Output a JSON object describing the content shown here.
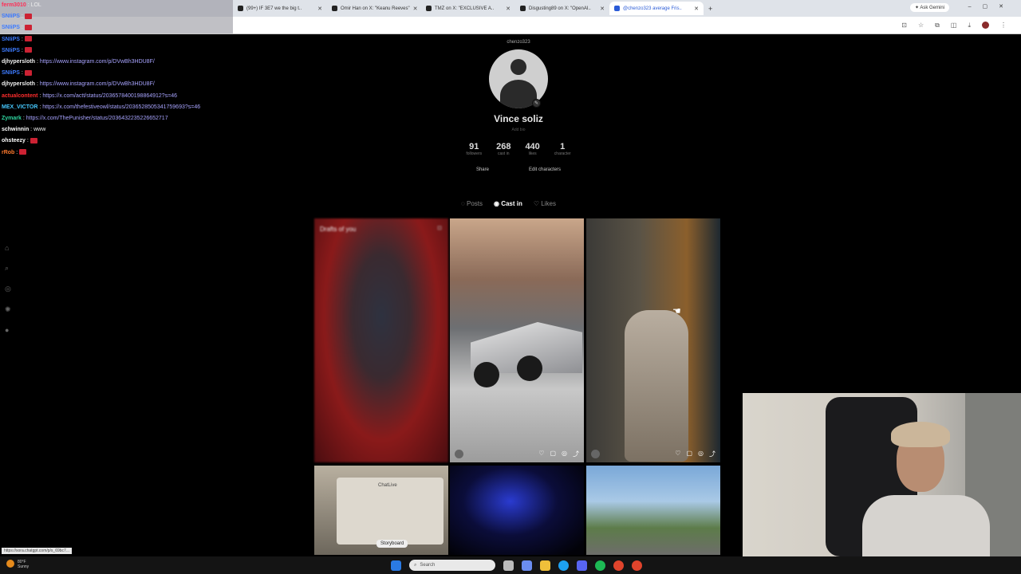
{
  "browser": {
    "tabs": [
      {
        "title": "(99+) IF 3E7 we the big t..",
        "color": "#222"
      },
      {
        "title": "Omir Han on X: \"Keanu Reeves\"",
        "color": "#222"
      },
      {
        "title": "TMZ on X: \"EXCLUSIVE A..",
        "color": "#222"
      },
      {
        "title": "Disgusting89 on X: \"OpenAI..",
        "color": "#222"
      },
      {
        "title": "@chenzo323 average Fris..",
        "color": "#2a5bd7"
      }
    ],
    "ask_gemini": "Ask Gemini"
  },
  "chat": {
    "messages": [
      {
        "user": "ferm3010",
        "text": "LOL",
        "color": "#ff2d55",
        "link": ""
      },
      {
        "user": "SNIiPS",
        "text": "",
        "color": "#3d7bff",
        "link": ""
      },
      {
        "user": "SNIiPS",
        "text": "",
        "color": "#3d7bff",
        "link": ""
      },
      {
        "user": "SNIiPS",
        "text": "",
        "color": "#3d7bff",
        "link": ""
      },
      {
        "user": "SNIiPS",
        "text": "",
        "color": "#3d7bff",
        "link": ""
      },
      {
        "user": "djhypersloth",
        "text": "",
        "color": "#f0f0f0",
        "link": "https://www.instagram.com/p/DVwBh3HDU8F/"
      },
      {
        "user": "SNIiPS",
        "text": "",
        "color": "#3d7bff",
        "link": ""
      },
      {
        "user": "djhypersloth",
        "text": "",
        "color": "#f0f0f0",
        "link": "https://www.instagram.com/p/DVwBh3HDU8F/"
      },
      {
        "user": "actualcontent",
        "text": "",
        "color": "#ff2d2d",
        "link": "https://x.com/actt/status/2036578400198864912?s=46"
      },
      {
        "user": "MEX_VICTOR",
        "text": "",
        "color": "#46c9ff",
        "link": "https://x.com/thefestiveowl/status/2036528505341759693?s=46"
      },
      {
        "user": "Zymark",
        "text": "",
        "color": "#2fd6a0",
        "link": "https://x.com/ThePunisher/status/2036432235226652717"
      },
      {
        "user": "schwinnin",
        "text": "www",
        "color": "#ffffff",
        "link": ""
      },
      {
        "user": "ohsteezy",
        "text": "",
        "color": "#ffffff",
        "link": ""
      },
      {
        "user": "rRob",
        "text": "",
        "color": "#ff7a2d",
        "link": ""
      }
    ]
  },
  "profile": {
    "handle": "chenzo323",
    "name": "Vince soliz",
    "bio_placeholder": "Add bio",
    "stats": [
      {
        "value": "91",
        "label": "followers"
      },
      {
        "value": "268",
        "label": "cast in"
      },
      {
        "value": "440",
        "label": "likes"
      },
      {
        "value": "1",
        "label": "character"
      }
    ],
    "share_label": "Share",
    "edit_characters_label": "Edit characters",
    "tabs": [
      {
        "label": "Posts",
        "icon": "posts-icon"
      },
      {
        "label": "Cast in",
        "icon": "cast-icon"
      },
      {
        "label": "Likes",
        "icon": "heart-icon"
      }
    ],
    "active_tab": "Cast in"
  },
  "grid": {
    "drafts_label": "Drafts of you",
    "storyboard_label": "Storyboard",
    "chatlive_label": "ChatLive"
  },
  "taskbar": {
    "temperature": "80°F",
    "weather": "Sunny",
    "search_placeholder": "Search"
  },
  "status_url": "https://sora.chatgpt.com/p/s_69bc7..."
}
